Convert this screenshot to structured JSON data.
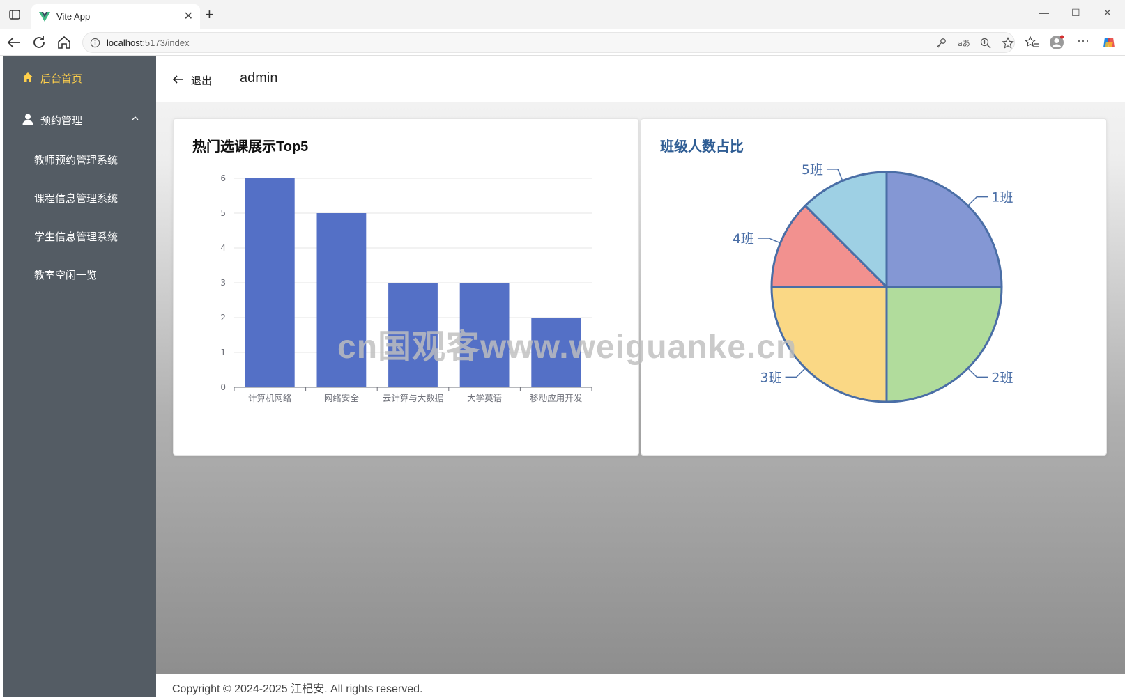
{
  "browser": {
    "tab_title": "Vite App",
    "url_host": "localhost",
    "url_path": ":5173/index"
  },
  "sidebar": {
    "items": [
      {
        "label": "后台首页",
        "icon": "home-icon",
        "active": true
      },
      {
        "label": "预约管理",
        "icon": "user-icon",
        "expanded": true,
        "children": [
          {
            "label": "教师预约管理系统"
          },
          {
            "label": "课程信息管理系统"
          },
          {
            "label": "学生信息管理系统"
          },
          {
            "label": "教室空闲一览"
          }
        ]
      }
    ],
    "background": "#545c64",
    "active_color": "#ffd04b"
  },
  "header": {
    "back_label": "退出",
    "username": "admin"
  },
  "bar_card": {
    "title": "热门选课展示Top5"
  },
  "pie_card": {
    "title": "班级人数占比",
    "title_color": "#2f5d94"
  },
  "footer": {
    "text": "Copyright © 2024-2025 江杞安. All rights reserved."
  },
  "watermark": "cn国观客www.weiguanke.cn",
  "chart_data": [
    {
      "type": "bar",
      "title": "热门选课展示Top5",
      "categories": [
        "计算机网络",
        "网络安全",
        "云计算与大数据",
        "大学英语",
        "移动应用开发"
      ],
      "values": [
        6,
        5,
        3,
        3,
        2
      ],
      "ylim": [
        0,
        6
      ],
      "yticks": [
        0,
        1,
        2,
        3,
        4,
        5,
        6
      ],
      "color": "#5470c6",
      "grid": true
    },
    {
      "type": "pie",
      "title": "班级人数占比",
      "labels": [
        "1班",
        "2班",
        "3班",
        "4班",
        "5班"
      ],
      "values": [
        25,
        25,
        25,
        12.5,
        12.5
      ],
      "colors": [
        "#8497d4",
        "#b1dc9c",
        "#fad885",
        "#f2918f",
        "#9ed0e4"
      ],
      "border_color": "#4a6ea6"
    }
  ]
}
